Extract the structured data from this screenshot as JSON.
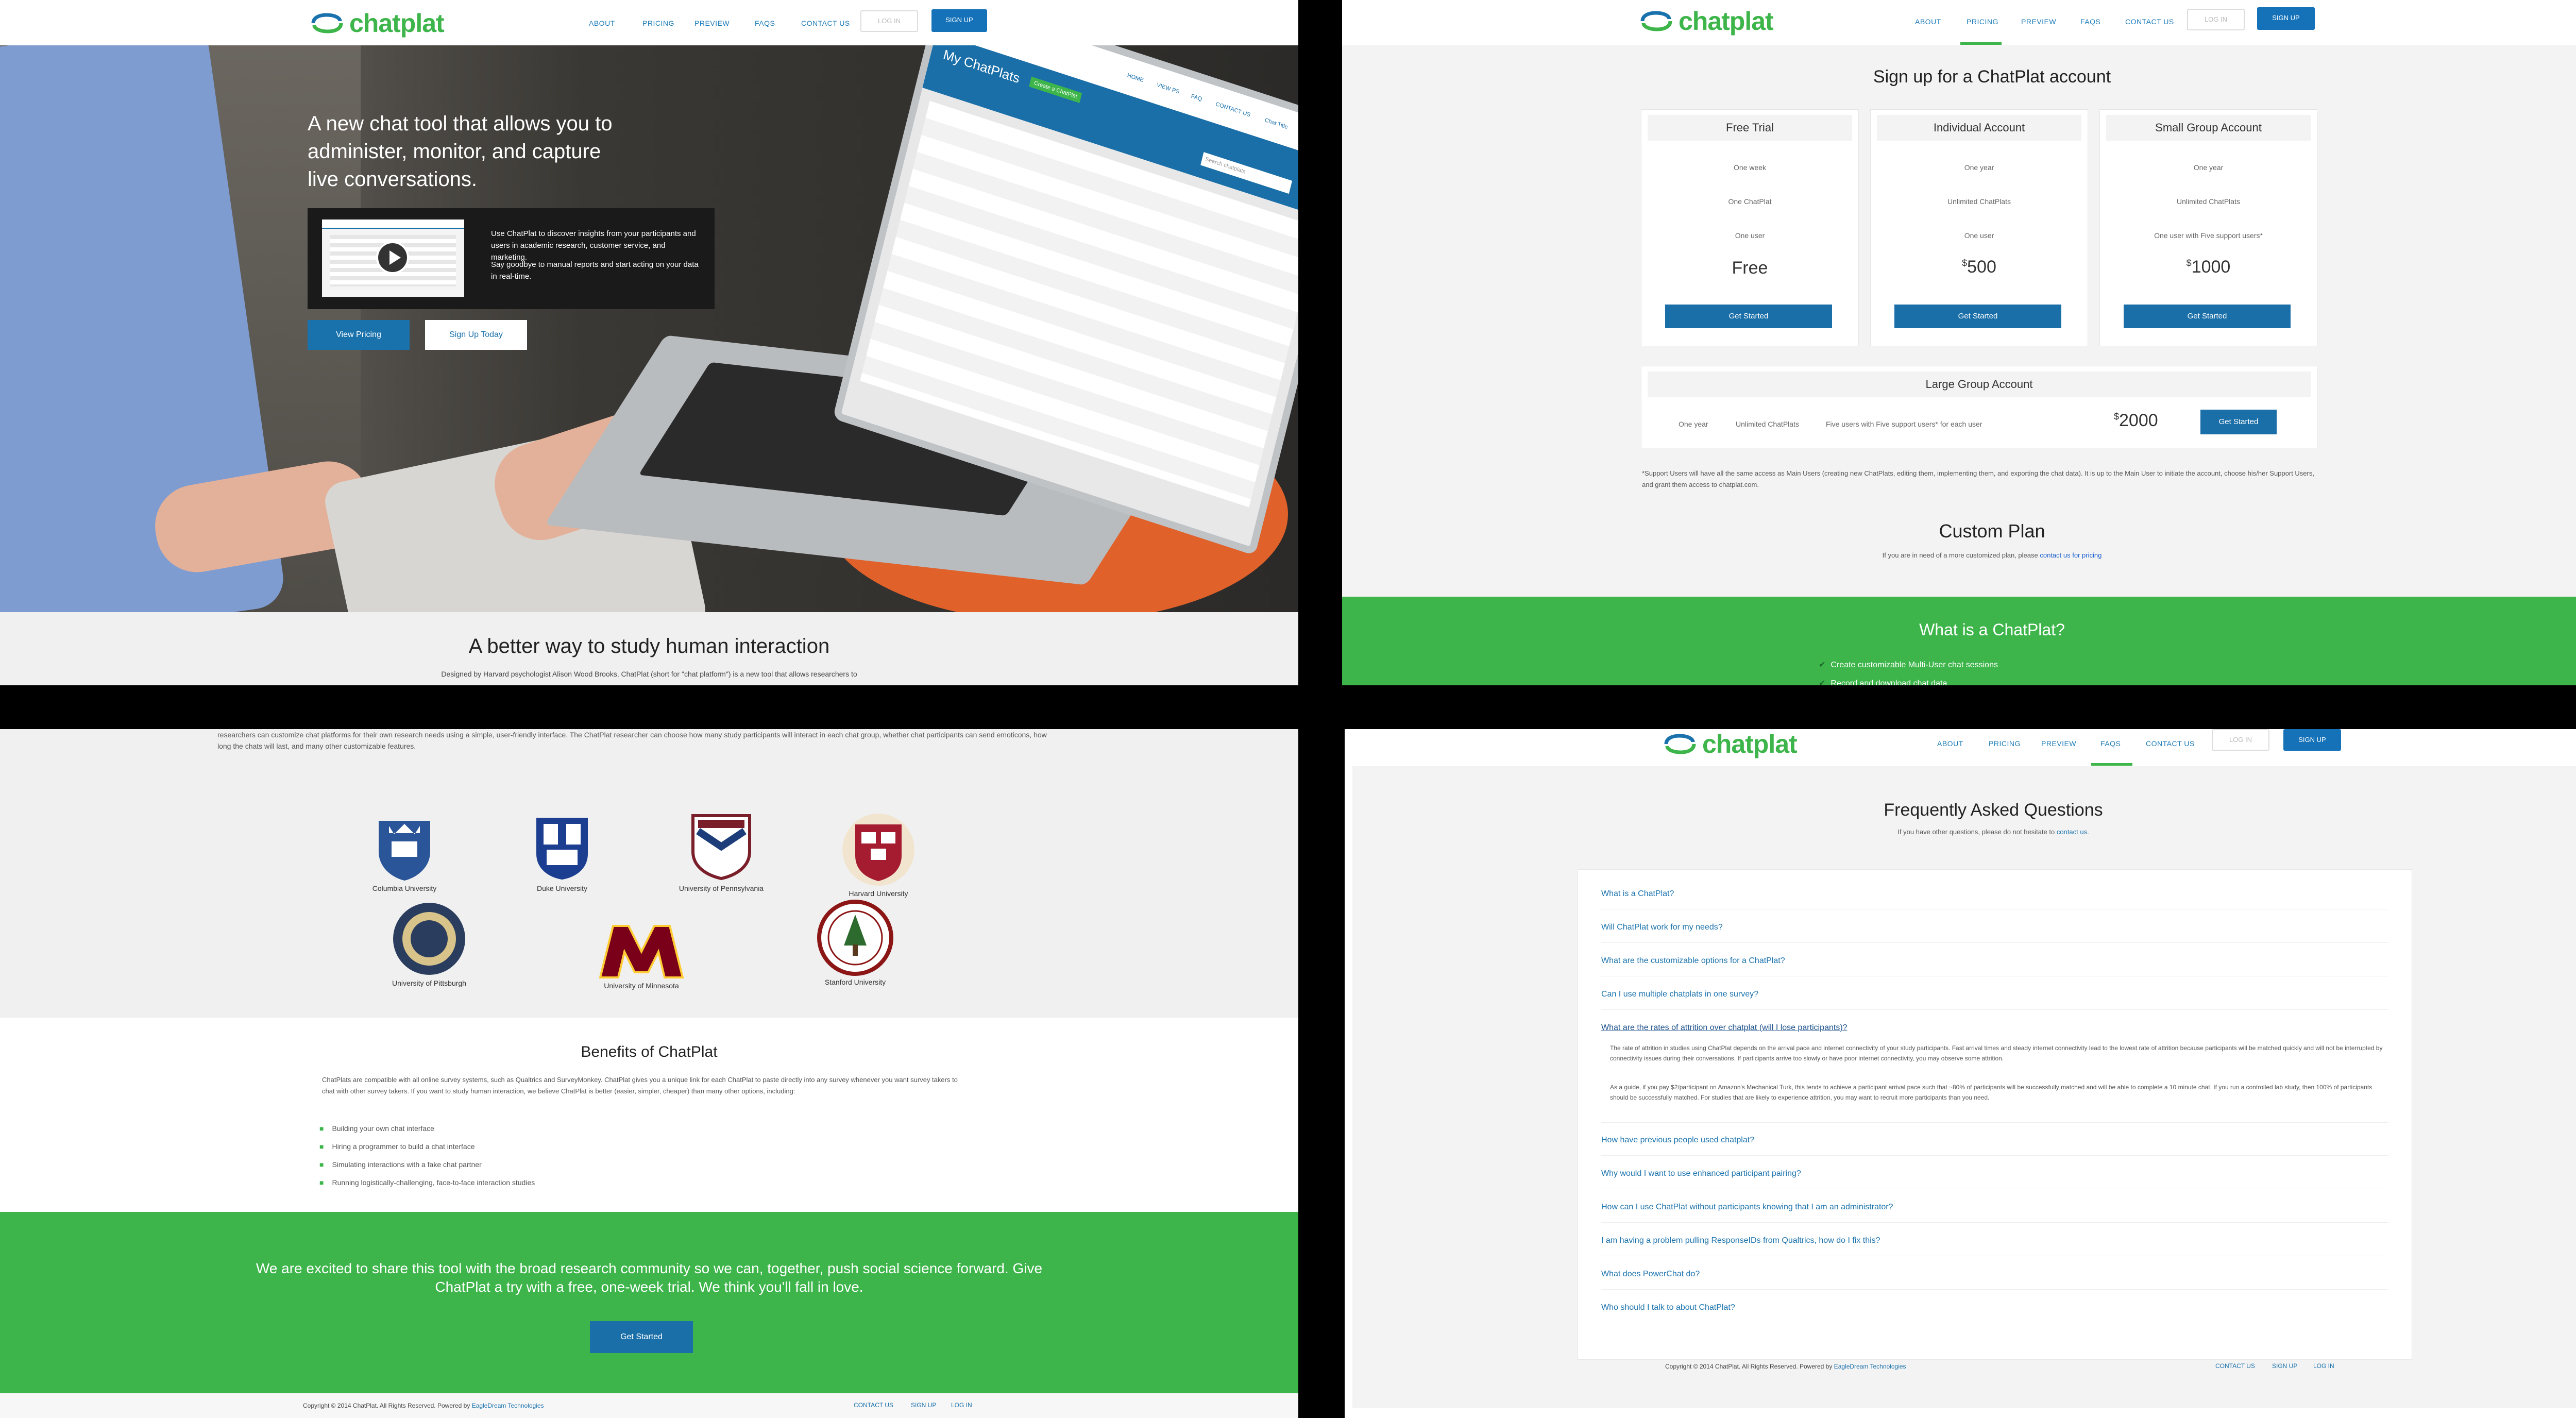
{
  "nav": {
    "brand": "chatplat",
    "about": "ABOUT",
    "pricing": "PRICING",
    "preview": "PREVIEW",
    "faqs": "FAQS",
    "contact": "CONTACT US",
    "login": "LOG IN",
    "signup": "SIGN UP"
  },
  "home": {
    "headline": [
      "A new chat tool that allows you to",
      "administer, monitor, and capture",
      "live conversations."
    ],
    "video_text1": "Use ChatPlat to discover insights from your participants and users in academic research, customer service, and marketing.",
    "video_text2": "Say goodbye to manual reports and start acting on your data in real-time.",
    "btn_pricing": "View Pricing",
    "btn_signup": "Sign Up Today",
    "laptop": {
      "title": "My ChatPlats",
      "create": "Create a ChatPlat",
      "search": "Search chatplats",
      "links": [
        "HOME",
        "VIEW PS",
        "FAQ",
        "CONTACT US",
        "Chat Title"
      ]
    },
    "section_title": "A better way to study human interaction",
    "section_lead": "Designed by Harvard psychologist Alison Wood Brooks, ChatPlat (short for \"chat platform\") is a new tool that allows researchers to"
  },
  "pricing": {
    "title": "Sign up for a ChatPlat account",
    "plans": [
      {
        "name": "Free Trial",
        "rows": [
          "One week",
          "One ChatPlat",
          "One user"
        ],
        "price": "Free",
        "cta": "Get Started"
      },
      {
        "name": "Individual Account",
        "rows": [
          "One year",
          "Unlimited ChatPlats",
          "One user"
        ],
        "price_sym": "$",
        "price": "500",
        "cta": "Get Started"
      },
      {
        "name": "Small Group Account",
        "rows": [
          "One year",
          "Unlimited ChatPlats",
          "One user with Five support users*"
        ],
        "price_sym": "$",
        "price": "1000",
        "cta": "Get Started"
      }
    ],
    "large": {
      "name": "Large Group Account",
      "rows": [
        "One year",
        "Unlimited ChatPlats",
        "Five users with Five support users* for each user"
      ],
      "price_sym": "$",
      "price": "2000",
      "cta": "Get Started"
    },
    "note": "*Support Users will have all the same access as Main Users (creating new ChatPlats, editing them, implementing them, and exporting the chat data). It is up to the Main User to initiate the account, choose his/her Support Users, and grant them access to chatplat.com.",
    "custom_title": "Custom Plan",
    "custom_text": "If you are in need of a more customized plan, please ",
    "custom_link": "contact us for pricing",
    "what_title": "What is a ChatPlat?",
    "what_item": "Create customizable Multi-User chat sessions",
    "what_item2": "Record and download chat data"
  },
  "about": {
    "lead": "researchers can customize chat platforms for their own research needs using a simple, user-friendly interface. The ChatPlat researcher can choose how many study participants will interact in each chat group, whether chat participants can send emoticons, how long the chats will last, and many other customizable features.",
    "universities": [
      "Columbia University",
      "Duke University",
      "University of Pennsylvania",
      "Harvard University",
      "University of Pittsburgh",
      "University of Minnesota",
      "Stanford University"
    ],
    "benefits_title": "Benefits of ChatPlat",
    "benefits_text": "ChatPlats are compatible with all online survey systems, such as Qualtrics and SurveyMonkey. ChatPlat gives you a unique link for each ChatPlat to paste directly into any survey whenever you want survey takers to chat with other survey takers. If you want to study human interaction, we believe ChatPlat is better (easier, simpler, cheaper) than many other options, including:",
    "benefits": [
      "Building your own chat interface",
      "Hiring a programmer to build a chat interface",
      "Simulating interactions with a fake chat partner",
      "Running logistically-challenging, face-to-face interaction studies"
    ],
    "cta_text": "We are excited to share this tool with the broad research community so we can, together, push social science forward. Give ChatPlat a try with a free, one-week trial. We think you'll fall in love.",
    "cta_btn": "Get Started"
  },
  "footer": {
    "copy": "Copyright © 2014 ChatPlat. All Rights Reserved. Powered by ",
    "powered": "EagleDream Technologies",
    "contact": "CONTACT US",
    "signup": "SIGN UP",
    "login": "LOG IN"
  },
  "faq": {
    "title": "Frequently Asked Questions",
    "sub": "If you have other questions, please do not hesitate to ",
    "sub_link": "contact us.",
    "questions": [
      "What is a ChatPlat?",
      "Will ChatPlat work for my needs?",
      "What are the customizable options for a ChatPlat?",
      "Can I use multiple chatplats in one survey?",
      "What are the rates of attrition over chatplat (will I lose participants)?",
      "How have previous people used chatplat?",
      "Why would I want to use enhanced participant pairing?",
      "How can I use ChatPlat without participants knowing that I am an administrator?",
      "I am having a problem pulling ResponseIDs from Qualtrics, how do I fix this?",
      "What does PowerChat do?",
      "Who should I talk to about ChatPlat?"
    ],
    "answer1": "The rate of attrition in studies using ChatPlat depends on the arrival pace and internet connectivity of your study participants. Fast arrival times and steady internet connectivity lead to the lowest rate of attrition because participants will be matched quickly and will not be interrupted by connectivity issues during their conversations. If participants arrive too slowly or have poor internet connectivity, you may observe some attrition.",
    "answer2": "As a guide, if you pay $2/participant on Amazon's Mechanical Turk, this tends to achieve a participant arrival pace such that ~80% of participants will be successfully matched and will be able to complete a 10 minute chat. If you run a controlled lab study, then 100% of participants should be successfully matched. For studies that are likely to experience attrition, you may want to recruit more participants than you need."
  },
  "colors": {
    "green": "#3db54a",
    "blue": "#1a72ad"
  }
}
